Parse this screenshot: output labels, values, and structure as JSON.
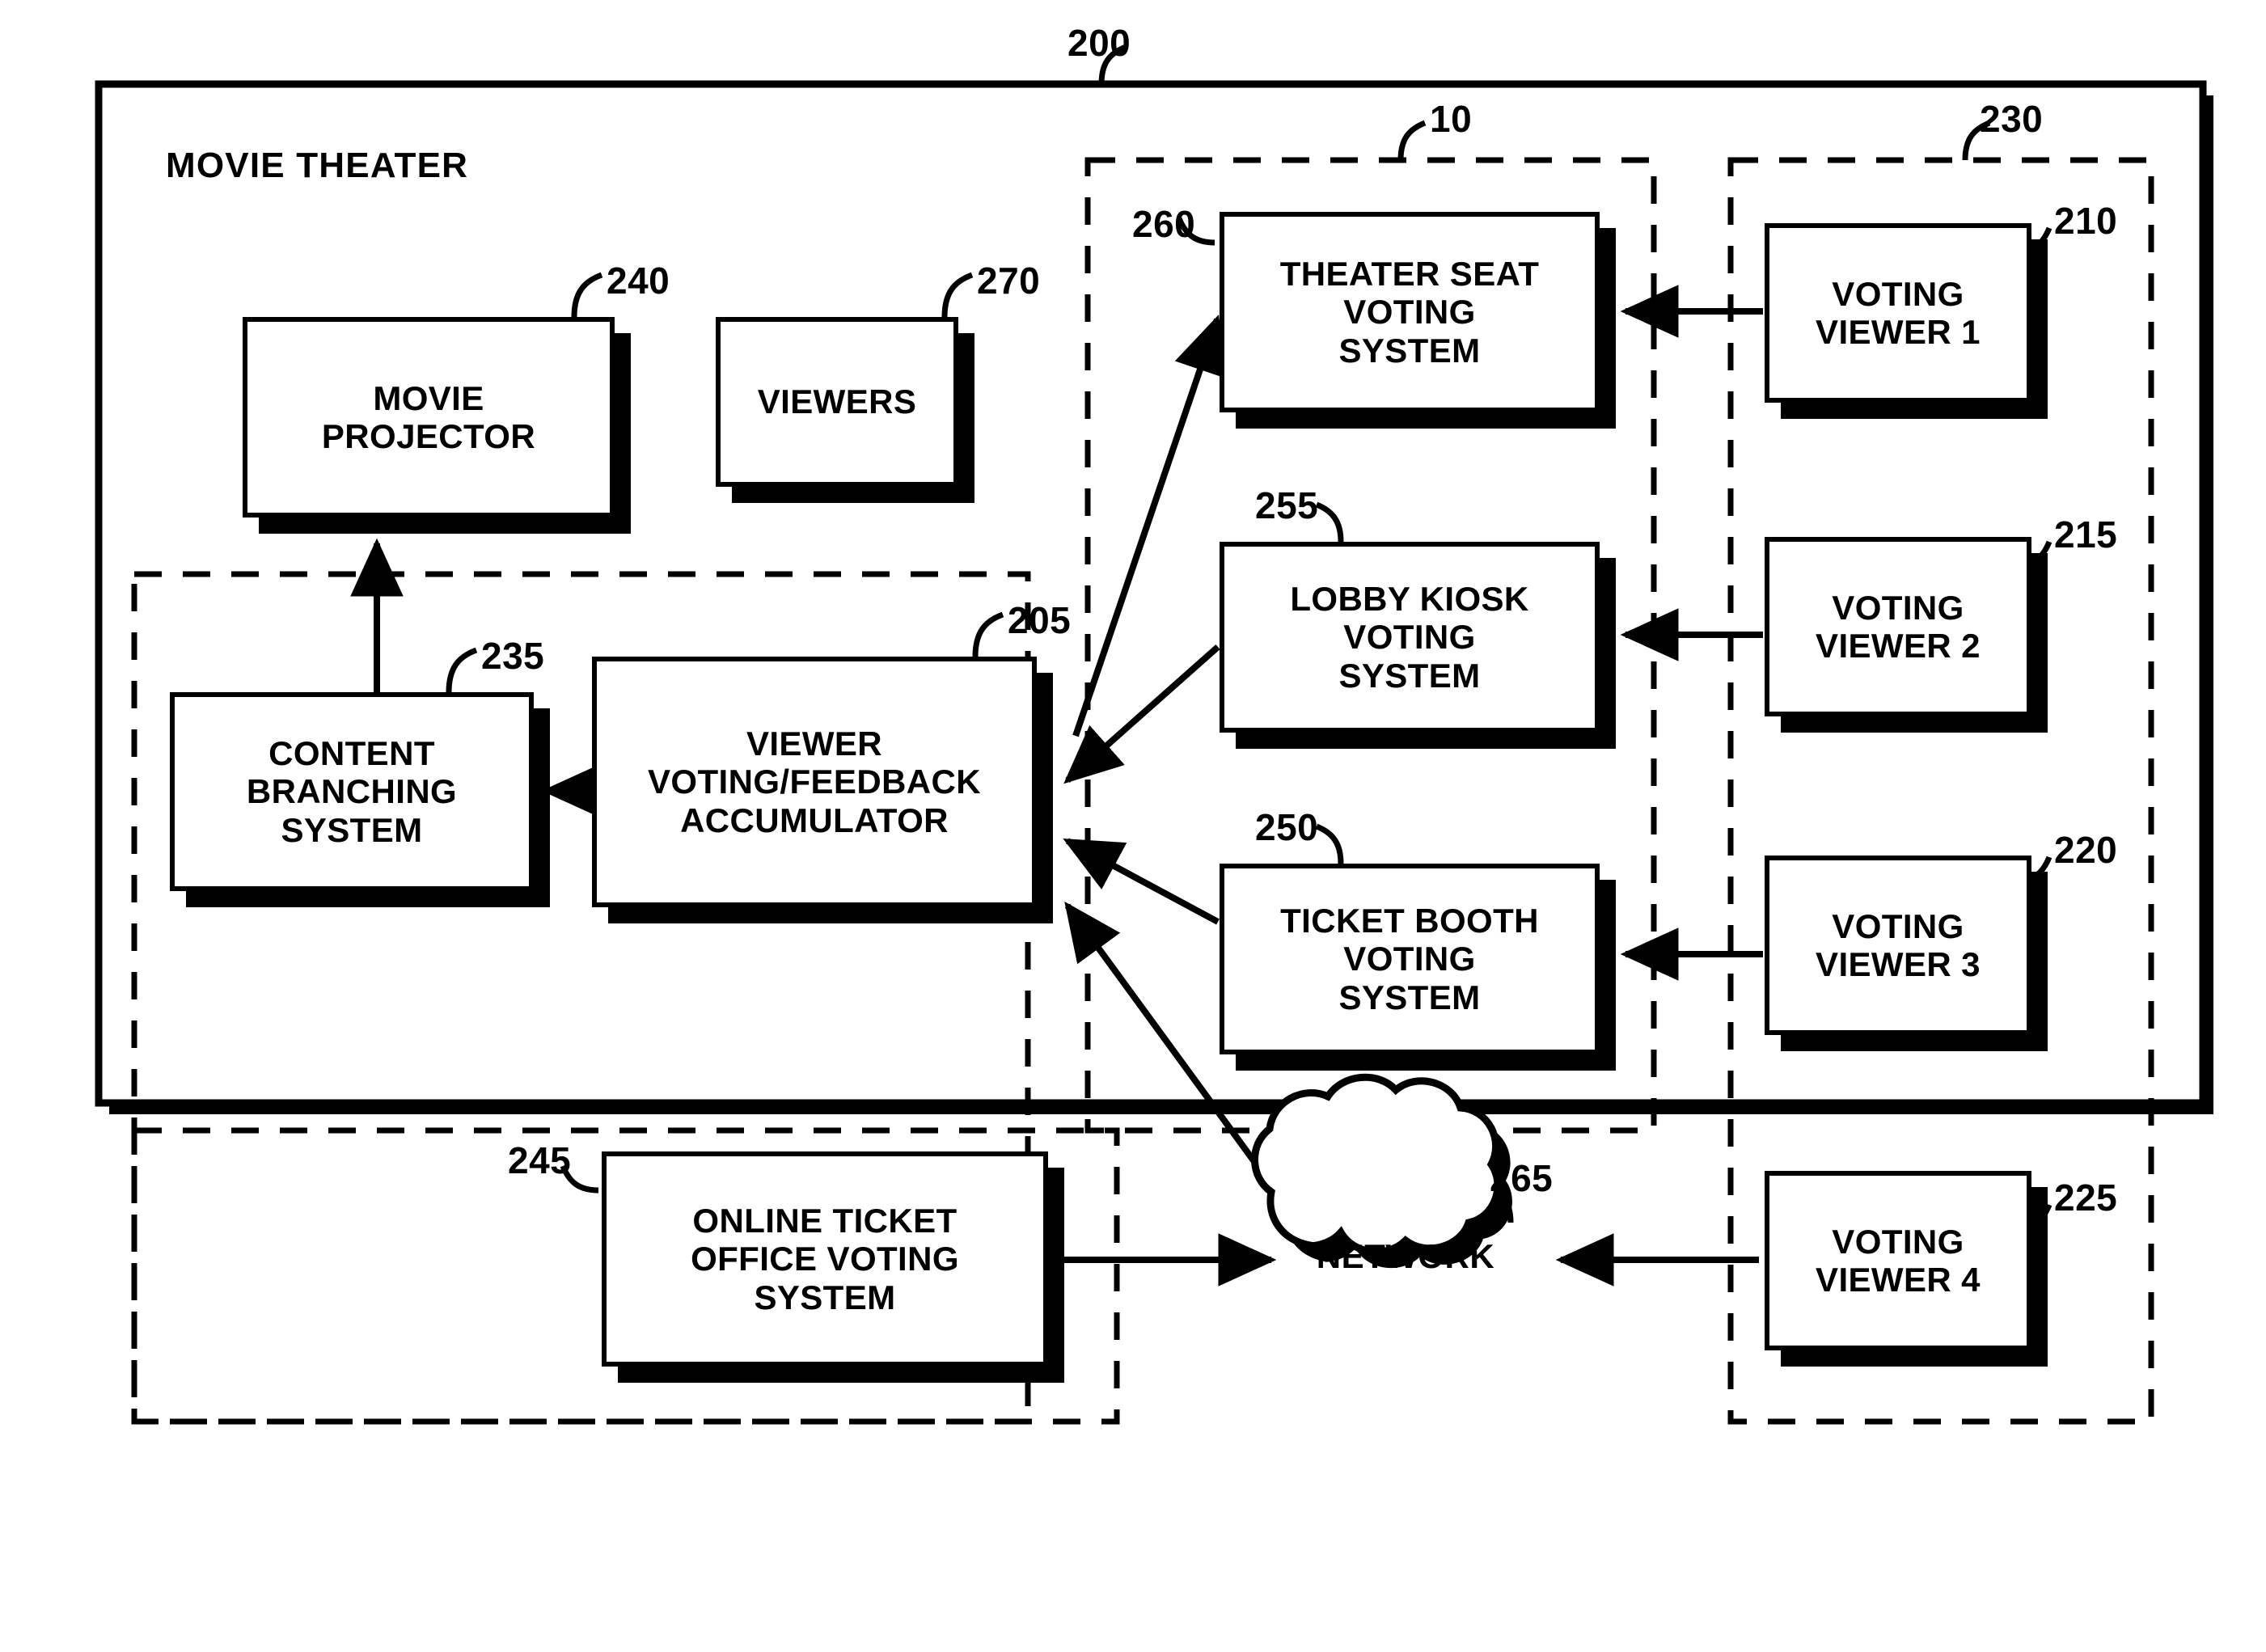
{
  "figure": {
    "section_title": "MOVIE THEATER",
    "outer_ref": "200",
    "theater_title_ref": "200"
  },
  "groups": [
    {
      "id": "voting-systems-group",
      "ref": "10"
    },
    {
      "id": "voting-viewers-group",
      "ref": "230"
    },
    {
      "id": "accumulator-group",
      "ref": ""
    },
    {
      "id": "online-office-group",
      "ref": ""
    }
  ],
  "boxes": {
    "movie_projector": {
      "label": "MOVIE\nPROJECTOR",
      "ref": "240"
    },
    "viewers": {
      "label": "VIEWERS",
      "ref": "270"
    },
    "content_branching": {
      "label": "CONTENT\nBRANCHING\nSYSTEM",
      "ref": "235"
    },
    "accumulator": {
      "label": "VIEWER\nVOTING/FEEDBACK\nACCUMULATOR",
      "ref": "205"
    },
    "theater_seat": {
      "label": "THEATER SEAT\nVOTING\nSYSTEM",
      "ref": "260"
    },
    "lobby_kiosk": {
      "label": "LOBBY KIOSK\nVOTING\nSYSTEM",
      "ref": "255"
    },
    "ticket_booth": {
      "label": "TICKET BOOTH\nVOTING\nSYSTEM",
      "ref": "250"
    },
    "online_ticket": {
      "label": "ONLINE TICKET\nOFFICE VOTING\nSYSTEM",
      "ref": "245"
    },
    "voting_viewer_1": {
      "label": "VOTING\nVIEWER 1",
      "ref": "210"
    },
    "voting_viewer_2": {
      "label": "VOTING\nVIEWER 2",
      "ref": "215"
    },
    "voting_viewer_3": {
      "label": "VOTING\nVIEWER 3",
      "ref": "220"
    },
    "voting_viewer_4": {
      "label": "VOTING\nVIEWER 4",
      "ref": "225"
    }
  },
  "cloud": {
    "label": "NETWORK",
    "ref": "265"
  },
  "colors": {
    "ink": "#000000",
    "paper": "#ffffff"
  }
}
